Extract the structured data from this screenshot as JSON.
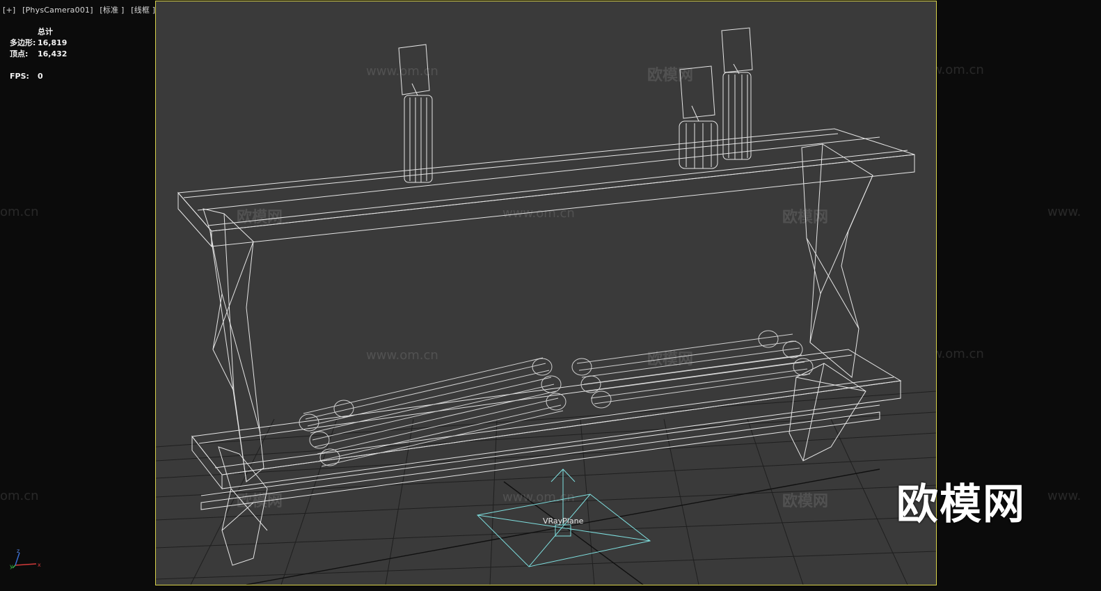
{
  "viewport": {
    "menu": "[+]",
    "camera": "[PhysCamera001]",
    "shading": "[标准 ]",
    "mode": "[线框 ]"
  },
  "stats": {
    "title": "总计",
    "polys_label": "多边形:",
    "polys_value": "16,819",
    "verts_label": "顶点:",
    "verts_value": "16,432",
    "fps_label": "FPS:",
    "fps_value": "0"
  },
  "scene": {
    "object_label": "VRayPlane"
  },
  "watermarks": {
    "cn": "欧模网",
    "url": "www.om.cn",
    "url_short": "om.cn",
    "url_prefix": "www.",
    "brand": "欧模网"
  },
  "axis": {
    "x": "x",
    "y": "y",
    "z": "z"
  },
  "colors": {
    "viewport_bg": "#3a3a3a",
    "border_active": "#d9d34a",
    "wire": "#e6e6e6",
    "gizmo": "#7fe0e0",
    "grid": "#1e1e1e"
  }
}
